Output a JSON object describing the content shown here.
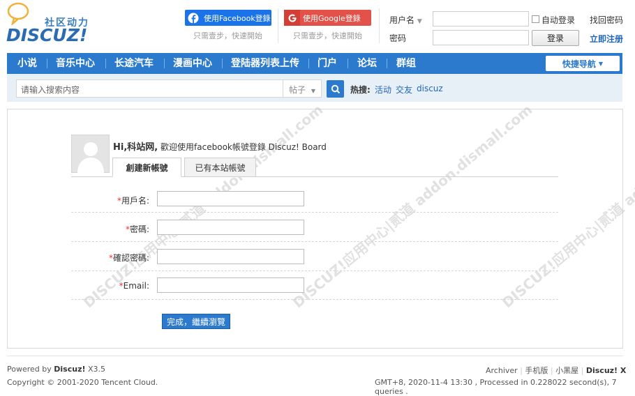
{
  "header": {
    "logo_cn": "社区动力",
    "logo_en": "DISCUZ!",
    "facebook": {
      "label": "使用Facebook登錄",
      "sub": "只需壹步，快速開始"
    },
    "google": {
      "label": "使用Google登錄",
      "sub": "只需壹步，快速開始"
    },
    "login": {
      "username_label": "用户名",
      "password_label": "密码",
      "auto_login": "自动登录",
      "login_button": "登录",
      "forgot": "找回密码",
      "register": "立即注册"
    }
  },
  "nav": {
    "items": [
      "小说",
      "音乐中心",
      "长途汽车",
      "漫画中心",
      "登陆器列表上传",
      "门户",
      "论坛",
      "群组"
    ],
    "quick": "快捷导航"
  },
  "search": {
    "placeholder": "请输入搜索内容",
    "type": "帖子",
    "hot_label": "热搜:",
    "hot_items": [
      "活动",
      "交友",
      "discuz"
    ]
  },
  "main": {
    "hi": "Hi,科站网,",
    "welcome": "歡迎使用facebook帳號登錄 Discuz! Board",
    "tabs": [
      "創建新帳號",
      "已有本站帳號"
    ],
    "fields": [
      {
        "label": "用戶名:"
      },
      {
        "label": "密碼:"
      },
      {
        "label": "確認密碼:"
      },
      {
        "label": "Email:"
      }
    ],
    "submit": "完成，繼續瀏覽",
    "watermark": "DISCUZ!应用中心|贰道 addon.dismall.com"
  },
  "footer": {
    "powered_prefix": "Powered by",
    "powered_brand": "Discuz!",
    "powered_version": "X3.5",
    "copyright": "Copyright © 2001-2020 Tencent Cloud.",
    "links": [
      "Archiver",
      "手机版",
      "小黑屋"
    ],
    "brand": "Discuz! X",
    "stats": "GMT+8, 2020-11-4 13:30 , Processed in 0.228022 second(s), 7 queries ."
  },
  "colors": {
    "nav": "#2b7acd",
    "facebook": "#1a73e8",
    "google": "#e2524a",
    "required": "#e33333"
  }
}
